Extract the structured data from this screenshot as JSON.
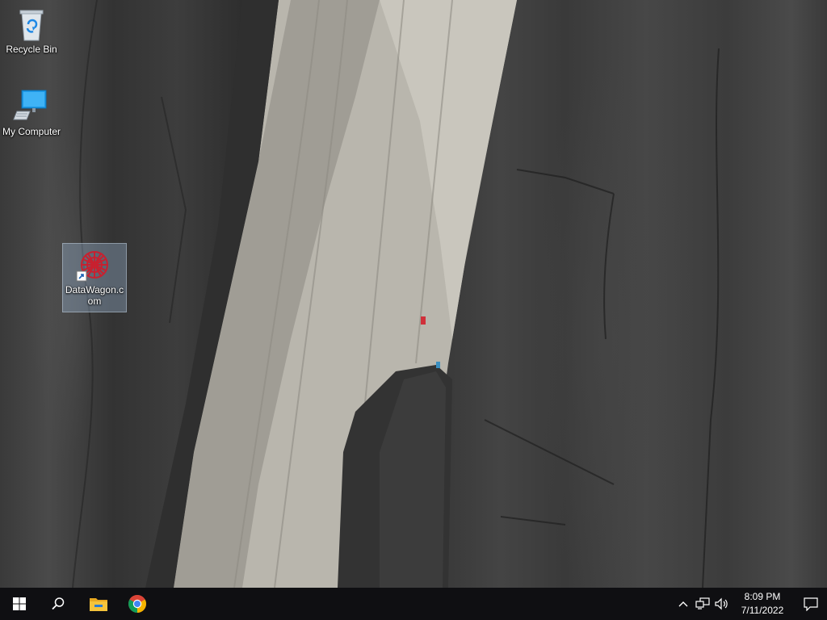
{
  "desktop": {
    "icons": [
      {
        "label": "Recycle Bin"
      },
      {
        "label": "My Computer"
      },
      {
        "label": "DataWagon.com"
      }
    ]
  },
  "taskbar": {
    "start": {
      "icon": "windows-logo-icon"
    },
    "search": {
      "icon": "search-icon"
    },
    "pinned": [
      {
        "icon": "file-explorer-icon"
      },
      {
        "icon": "chrome-icon"
      }
    ],
    "tray": {
      "icons": [
        "chevron-up-icon",
        "network-icon",
        "volume-icon"
      ],
      "time": "8:09 PM",
      "date": "7/11/2022",
      "notification_icon": "action-center-icon"
    }
  },
  "colors": {
    "taskbar_bg": "#0f0f12",
    "folder_yellow": "#f5c33b",
    "chrome_red": "#db4437",
    "chrome_green": "#0f9d58",
    "chrome_yellow": "#f4b400",
    "chrome_blue": "#4285f4",
    "datawagon_red": "#c8202f"
  }
}
